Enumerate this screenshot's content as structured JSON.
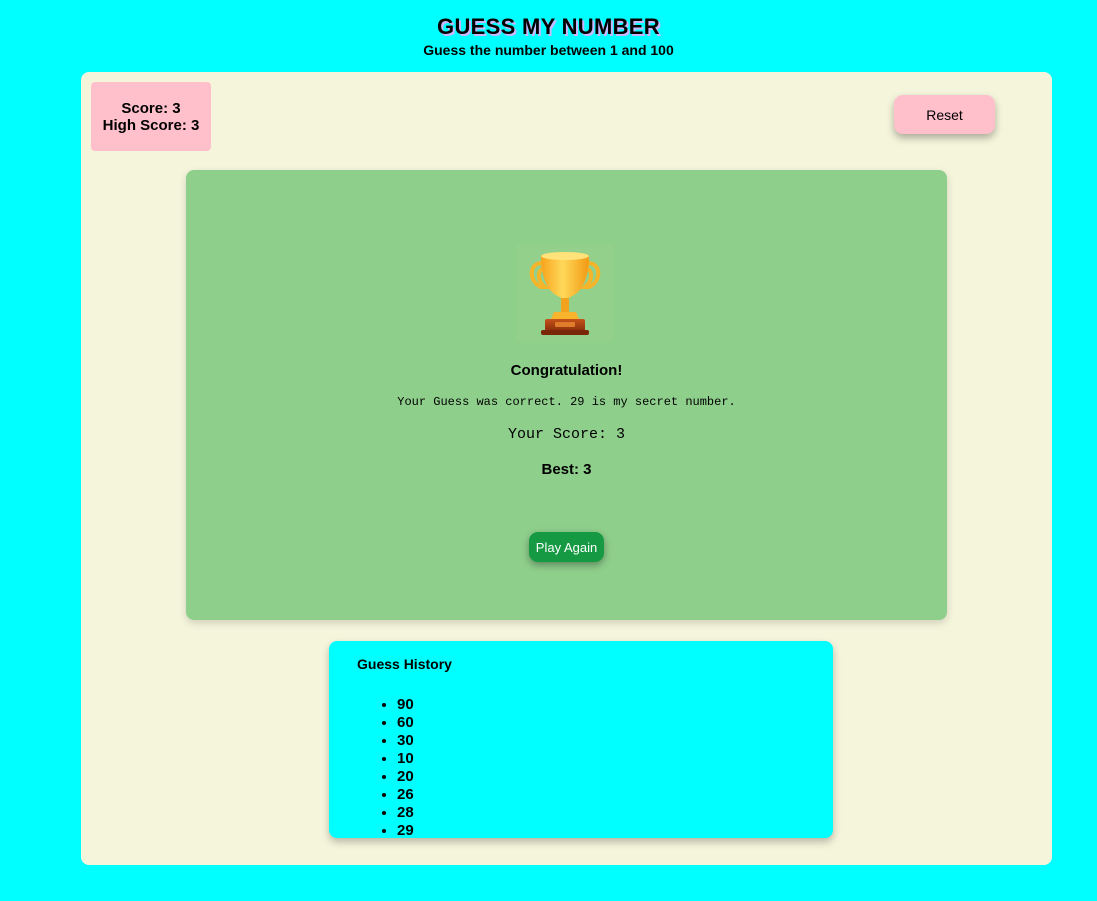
{
  "header": {
    "title": "GUESS MY NUMBER",
    "subtitle": "Guess the number between 1 and 100"
  },
  "scoreboard": {
    "score_label": "Score: 3",
    "high_score_label": "High Score: 3"
  },
  "toolbar": {
    "reset_label": "Reset"
  },
  "result": {
    "icon": "trophy-icon",
    "heading": "Congratulation!",
    "message": "Your Guess was correct. 29 is my secret number.",
    "score_line": "Your Score: 3",
    "best_line": "Best: 3",
    "play_again_label": "Play Again"
  },
  "history": {
    "title": "Guess History",
    "guesses": [
      "90",
      "60",
      "30",
      "10",
      "20",
      "26",
      "28",
      "29"
    ]
  },
  "colors": {
    "background": "#00ffff",
    "board": "#f5f5dc",
    "score_box": "#ffc0cb",
    "result_card": "#8fcf8c",
    "play_again_button": "#159a43",
    "history_panel": "#00ffff"
  }
}
